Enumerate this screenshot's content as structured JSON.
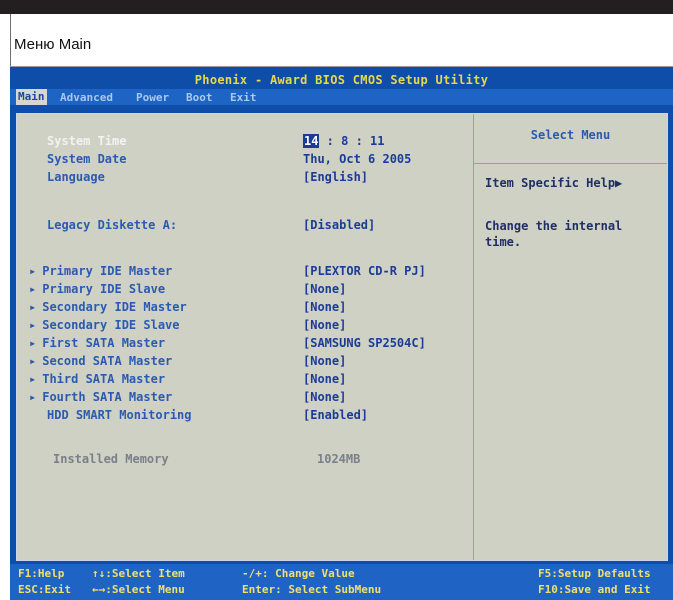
{
  "caption": "Меню Main",
  "bios": {
    "title": "Phoenix - Award BIOS CMOS Setup Utility",
    "menus": [
      "Main",
      "Advanced",
      "Power",
      "Boot",
      "Exit"
    ],
    "settings": {
      "system_time": {
        "label": "System Time",
        "hour": "14",
        "rest": " : 8 : 11"
      },
      "system_date": {
        "label": "System Date",
        "value": "Thu, Oct 6 2005"
      },
      "language": {
        "label": "Language",
        "value": "[English]"
      },
      "legacy_diskette": {
        "label": "Legacy Diskette A:",
        "value": "[Disabled]"
      },
      "primary_ide_master": {
        "label": "Primary IDE Master",
        "value": "[PLEXTOR CD-R   PJ]"
      },
      "primary_ide_slave": {
        "label": "Primary IDE Slave",
        "value": "[None]"
      },
      "secondary_ide_master": {
        "label": "Secondary IDE Master",
        "value": "[None]"
      },
      "secondary_ide_slave": {
        "label": "Secondary IDE Slave",
        "value": "[None]"
      },
      "first_sata_master": {
        "label": "First SATA Master",
        "value": "[SAMSUNG SP2504C]"
      },
      "second_sata_master": {
        "label": "Second SATA Master",
        "value": "[None]"
      },
      "third_sata_master": {
        "label": "Third SATA Master",
        "value": "[None]"
      },
      "fourth_sata_master": {
        "label": "Fourth SATA Master",
        "value": "[None]"
      },
      "hdd_smart": {
        "label": "HDD SMART Monitoring",
        "value": "[Enabled]"
      },
      "installed_memory": {
        "label": "Installed Memory",
        "value": "1024MB"
      }
    },
    "help": {
      "title": "Select Menu",
      "specific": "Item Specific Help▶",
      "text": "Change the internal\ntime."
    },
    "footer": {
      "f1": "F1:Help",
      "select_item": "↑↓:Select Item",
      "change_value": "-/+: Change Value",
      "f5": "F5:Setup Defaults",
      "esc": "ESC:Exit",
      "select_menu": "←→:Select Menu",
      "enter": "Enter: Select SubMenu",
      "f10": "F10:Save and Exit"
    }
  }
}
